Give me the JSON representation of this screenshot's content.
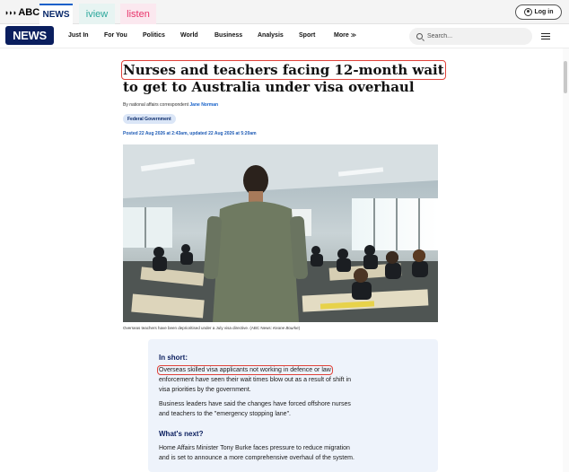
{
  "header": {
    "abc_logo_text": "ABC",
    "tabs": [
      {
        "label": "NEWS"
      },
      {
        "label": "iview"
      },
      {
        "label": "listen"
      }
    ],
    "login_label": "Log in"
  },
  "nav": {
    "logo_text": "NEWS",
    "items": [
      {
        "label": "Just In"
      },
      {
        "label": "For You"
      },
      {
        "label": "Politics"
      },
      {
        "label": "World"
      },
      {
        "label": "Business"
      },
      {
        "label": "Analysis"
      },
      {
        "label": "Sport"
      },
      {
        "label": "More"
      }
    ],
    "search_placeholder": "Search..."
  },
  "article": {
    "headline_highlighted": "Nurses and teachers facing 12-month wait",
    "headline_rest": " to get to Australia under visa overhaul",
    "byline_prefix": "By national affairs correspondent ",
    "byline_author": "Jane Norman",
    "tag": "Federal Government",
    "dateline": "Posted 22 Aug 2026 at 2:43am, updated 22 Aug 2026 at 5:20am",
    "caption_text": "Overseas teachers have been deprioritised under a July visa directive. (ABC News: ",
    "caption_credit": "Keane Bourke",
    "caption_end": ")"
  },
  "summary": {
    "in_short_heading": "In short:",
    "p1_highlighted": "Overseas skilled visa applicants not working in defence or law",
    "p1_rest_line2": "enforcement have seen their wait times blow out as a result of shift in",
    "p1_rest_line3": "visa priorities by the government.",
    "p2_line1": "Business leaders have said the changes have forced offshore nurses",
    "p2_line2": "and teachers to the \"emergency stopping lane\".",
    "whats_next_heading": "What's next?",
    "p3_line1": "Home Affairs Minister Tony Burke faces pressure to reduce migration",
    "p3_line2": "and is set to announce a more comprehensive overhaul of the system."
  },
  "colors": {
    "brand_navy": "#0a1e5e",
    "link_blue": "#1560c9",
    "highlight_red": "#e0423a",
    "summary_bg": "#eef3fb"
  }
}
